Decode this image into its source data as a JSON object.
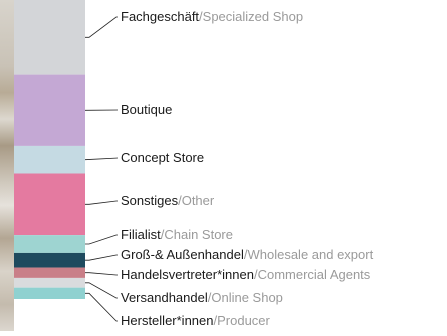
{
  "chart_data": {
    "type": "bar",
    "orientation": "stacked-vertical-100",
    "series": [
      {
        "label_de": "Fachgeschäft",
        "label_en": "Specialized Shop",
        "value": 23.0,
        "color": "#d3d5d8"
      },
      {
        "label_de": "Boutique",
        "label_en": "",
        "value": 22.0,
        "color": "#c4a8d4"
      },
      {
        "label_de": "Concept Store",
        "label_en": "",
        "value": 8.5,
        "color": "#c5dae3"
      },
      {
        "label_de": "Sonstiges",
        "label_en": "Other",
        "value": 19.0,
        "color": "#e47aa0"
      },
      {
        "label_de": "Filialist",
        "label_en": "Chain Store",
        "value": 5.5,
        "color": "#9ed4d1"
      },
      {
        "label_de": "Groß-& Außenhandel",
        "label_en": "Wholesale and export",
        "value": 4.5,
        "color": "#1e4a5e"
      },
      {
        "label_de": "Handelsvertreter*innen",
        "label_en": "Commercial Agents",
        "value": 3.2,
        "color": "#c97f88"
      },
      {
        "label_de": "Versandhandel",
        "label_en": "Online Shop",
        "value": 3.0,
        "color": "#d9dbdd"
      },
      {
        "label_de": "Hersteller*innen",
        "label_en": "Producer",
        "value": 3.5,
        "color": "#8fd1d0"
      }
    ],
    "separator": "/"
  }
}
